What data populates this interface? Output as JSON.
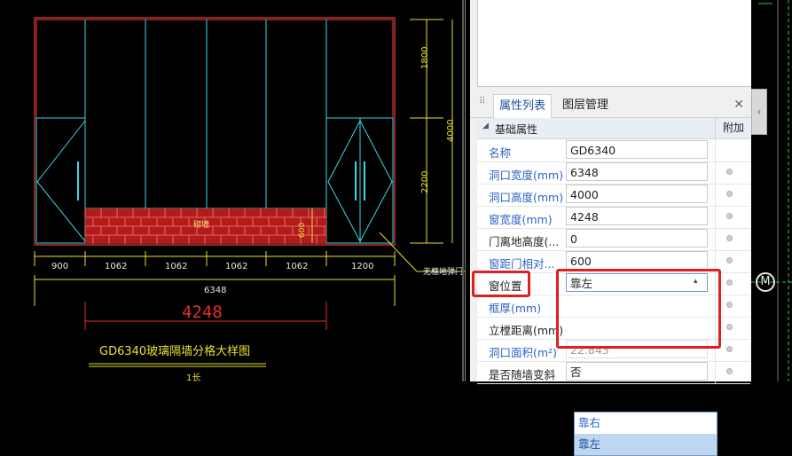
{
  "cad": {
    "dims_vertical": [
      "1800",
      "4000",
      "2200",
      "600"
    ],
    "dims_horizontal": [
      "900",
      "1062",
      "1062",
      "1062",
      "1062",
      "1200"
    ],
    "overall_width": "6348",
    "window_width": "4248",
    "brick_label": "砌墙",
    "side_note": "无框地弹门",
    "drawing_title": "GD6340玻璃隔墙分格大样图",
    "bottom_text": "1长"
  },
  "panel": {
    "tabs": [
      "属性列表",
      "图层管理"
    ],
    "close_icon": "close-icon",
    "group": {
      "label": "基础属性",
      "attach_header": "附加"
    },
    "rows": [
      {
        "name": "名称",
        "value": "GD6340",
        "color": "blue",
        "has_dot": false
      },
      {
        "name": "洞口宽度(mm)",
        "value": "6348",
        "color": "blue",
        "has_dot": true
      },
      {
        "name": "洞口高度(mm)",
        "value": "4000",
        "color": "blue",
        "has_dot": true
      },
      {
        "name": "窗宽度(mm)",
        "value": "4248",
        "color": "blue",
        "has_dot": true
      },
      {
        "name": "门离地高度(...",
        "value": "0",
        "color": "black",
        "has_dot": true
      },
      {
        "name": "窗距门相对...",
        "value": "600",
        "color": "blue",
        "has_dot": true
      },
      {
        "name": "窗位置",
        "value": "靠左",
        "color": "black",
        "has_dot": true,
        "dropdown": true
      },
      {
        "name": "框厚(mm)",
        "value": "",
        "color": "blue",
        "has_dot": true
      },
      {
        "name": "立樘距离(mm)",
        "value": "",
        "color": "black",
        "has_dot": true
      },
      {
        "name": "洞口面积(m²)",
        "value": "22.843",
        "color": "blue",
        "has_dot": true,
        "gray": true
      },
      {
        "name": "是否随墙变斜",
        "value": "否",
        "color": "black",
        "has_dot": true
      }
    ],
    "dropdown_options": [
      "靠右",
      "靠左"
    ],
    "dropdown_selected": "靠左"
  },
  "right_pane": {
    "collapse_icon": "chevron-left-icon",
    "marker_label": "M"
  }
}
